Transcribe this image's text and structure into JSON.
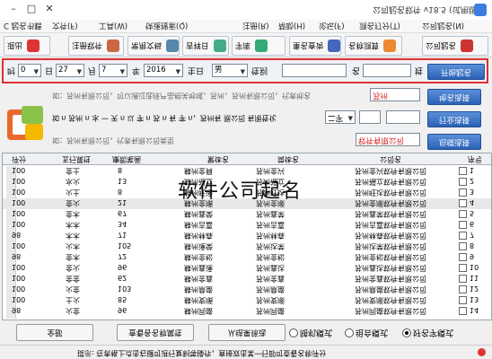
{
  "window": {
    "title": "公司起名软件 v18.5 (试用版)",
    "controls": [
      "–",
      "□",
      "✕"
    ]
  },
  "menu": {
    "items": [
      "公司起名(N)",
      "测名打分(T)",
      "论坛(F)",
      "帮助(H)",
      "注册(R)",
      "快速搜索(Q)",
      "工具(W)",
      "文件(F)"
    ],
    "extra": "C 起名书籍"
  },
  "toolbar": {
    "buttons": [
      {
        "label": "公司起名",
        "icon": "company-icon"
      },
      {
        "label": "名称测算",
        "icon": "measure-icon"
      },
      {
        "label": "重名查询",
        "icon": "search-icon"
      },
      {
        "label": "字库",
        "icon": "font-icon"
      },
      {
        "label": "吉祥日",
        "icon": "calendar-icon"
      },
      {
        "label": "常用文档",
        "icon": "doc-icon"
      },
      {
        "label": "注册软件",
        "icon": "register-icon"
      },
      {
        "label": "退出",
        "icon": "exit-icon"
      }
    ]
  },
  "form": {
    "surname_label": "姓",
    "name_label": "名",
    "gender_label": "性别",
    "gender_value": "男",
    "birth_label": "生日",
    "year_value": "2016",
    "year_label": "年",
    "month_value": "7",
    "month_label": "月",
    "day_value": "27",
    "day_label": "日",
    "hour_value": "0",
    "hour_label": "时",
    "start_button": "开始起名"
  },
  "options": {
    "row1_text": "如：苏州有限公司，可以通过选择产品相关地域，苏州，苏州有限公司，代表地名",
    "row1_button": "地名选择",
    "row1_field": "苏州",
    "row2_text": "如 n 苏州 n 水 一 天 n 以 字 n 苏 n 有 字 n，苏州有 限公司 有限性化",
    "row2_select": "二字",
    "row2_button": "行业选择",
    "row3_text": "如：苏州有限公司，代表有限公司类型",
    "row3_field": "软件有限公司",
    "row3_button": "后缀选择"
  },
  "table": {
    "headers": [
      "序号",
      "公司名",
      "简体名",
      "繁体名",
      "康熙笔画",
      "五行属性",
      "评分"
    ],
    "rows": [
      {
        "no": "1",
        "name": "苏州金兴软件有限公司",
        "simp": "苏州金兴",
        "trad": "蘇州金興",
        "strokes": "8",
        "element": "金土",
        "score": "100"
      },
      {
        "no": "2",
        "name": "苏州福立软件有限公司",
        "simp": "苏州福立",
        "trad": "蘇州福立",
        "strokes": "13",
        "element": "水火",
        "score": "100"
      },
      {
        "no": "3",
        "name": "苏州旺达软件有限公司",
        "simp": "苏州旺达",
        "trad": "蘇州旺達",
        "strokes": "8",
        "element": "火土",
        "score": "100"
      },
      {
        "no": "4",
        "name": "苏州金顺软件有限公司",
        "simp": "苏州金顺",
        "trad": "蘇州金順",
        "strokes": "21",
        "element": "金火",
        "score": "100"
      },
      {
        "no": "5",
        "name": "苏州鑫荣软件有限公司",
        "simp": "苏州鑫荣",
        "trad": "蘇州鑫榮",
        "strokes": "67",
        "element": "金木",
        "score": "100"
      },
      {
        "no": "6",
        "name": "苏州吉嘉软件有限公司",
        "simp": "苏州吉嘉",
        "trad": "蘇州吉嘉",
        "strokes": "34",
        "element": "木木",
        "score": "100"
      },
      {
        "no": "7",
        "name": "苏州林森软件有限公司",
        "simp": "苏州林森",
        "trad": "蘇州林森",
        "strokes": "71",
        "element": "木木",
        "score": "98"
      },
      {
        "no": "8",
        "name": "苏州达荣软件有限公司",
        "simp": "苏州达荣",
        "trad": "蘇州達榮",
        "strokes": "105",
        "element": "火木",
        "score": "100"
      },
      {
        "no": "9",
        "name": "苏州金松软件有限公司",
        "simp": "苏州金松",
        "trad": "蘇州金松",
        "strokes": "72",
        "element": "金木",
        "score": "98"
      },
      {
        "no": "10",
        "name": "苏州鑫达软件有限公司",
        "simp": "苏州鑫达",
        "trad": "蘇州鑫達",
        "strokes": "96",
        "element": "金火",
        "score": "100"
      },
      {
        "no": "11",
        "name": "苏州金鑫软件有限公司",
        "simp": "苏州金鑫",
        "trad": "蘇州金鑫",
        "strokes": "62",
        "element": "金金",
        "score": "100"
      },
      {
        "no": "12",
        "name": "苏州鼎盛软件有限公司",
        "simp": "苏州鼎盛",
        "trad": "蘇州鼎盛",
        "strokes": "103",
        "element": "火金",
        "score": "100"
      },
      {
        "no": "13",
        "name": "苏州安顺软件有限公司",
        "simp": "苏州安顺",
        "trad": "蘇州安順",
        "strokes": "85",
        "element": "土火",
        "score": "100"
      },
      {
        "no": "14",
        "name": "苏州同盛软件有限公司",
        "simp": "苏州同盛",
        "trad": "蘇州同盛",
        "strokes": "96",
        "element": "火金",
        "score": "98"
      }
    ]
  },
  "watermark": "软件公司起名",
  "bottom": {
    "radio_options": [
      "好名字模式",
      "组合模式",
      "随机模式"
    ],
    "buttons": [
      "从结果筛选",
      "查看各名称属性",
      "全部"
    ]
  },
  "status": "提示: 在表格上点击右键可进行复制等操作，直接双击某一行即可查看名称评分"
}
